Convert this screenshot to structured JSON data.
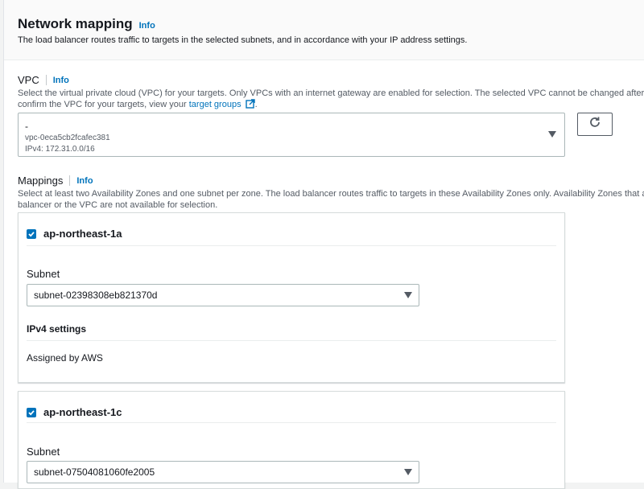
{
  "section": {
    "title": "Network mapping",
    "info": "Info",
    "description": "The load balancer routes traffic to targets in the selected subnets, and in accordance with your IP address settings."
  },
  "vpc": {
    "label": "VPC",
    "info": "Info",
    "help_line1": "Select the virtual private cloud (VPC) for your targets. Only VPCs with an internet gateway are enabled for selection. The selected VPC cannot be changed after the l",
    "help_line2_prefix": "confirm the VPC for your targets, view your",
    "help_link": "target groups",
    "help_suffix": ".",
    "selected_name": "-",
    "selected_id": "vpc-0eca5cb2fcafec381",
    "selected_cidr": "IPv4: 172.31.0.0/16"
  },
  "mappings": {
    "label": "Mappings",
    "info": "Info",
    "help_line1": "Select at least two Availability Zones and one subnet per zone. The load balancer routes traffic to targets in these Availability Zones only. Availability Zones that are",
    "help_line2": "balancer or the VPC are not available for selection.",
    "zones": [
      {
        "name": "ap-northeast-1a",
        "checked": true,
        "subnet_label": "Subnet",
        "subnet_value": "subnet-02398308eb821370d",
        "ipv4_label": "IPv4 settings",
        "ipv4_value": "Assigned by AWS"
      },
      {
        "name": "ap-northeast-1c",
        "checked": true,
        "subnet_label": "Subnet",
        "subnet_value": "subnet-07504081060fe2005"
      }
    ]
  },
  "icons": {
    "refresh": "refresh-icon",
    "external": "external-link-icon",
    "caret": "caret-down-icon",
    "check": "check-icon"
  },
  "colors": {
    "link": "#0073bb",
    "checkbox": "#0073bb"
  }
}
